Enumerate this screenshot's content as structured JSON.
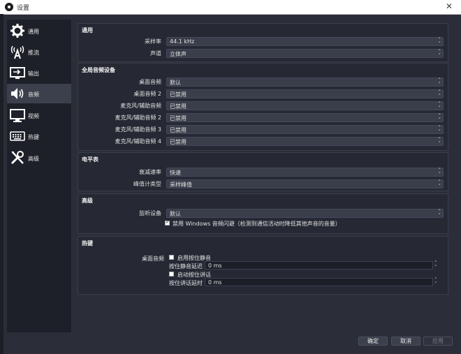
{
  "window": {
    "title": "设置",
    "close_glyph": "✕"
  },
  "sidebar": {
    "items": [
      {
        "label": "通用",
        "icon": "gear-icon",
        "active": false
      },
      {
        "label": "推流",
        "icon": "antenna-icon",
        "active": false
      },
      {
        "label": "输出",
        "icon": "output-icon",
        "active": false
      },
      {
        "label": "音频",
        "icon": "speaker-icon",
        "active": true
      },
      {
        "label": "视频",
        "icon": "monitor-icon",
        "active": false
      },
      {
        "label": "热键",
        "icon": "keyboard-icon",
        "active": false
      },
      {
        "label": "高级",
        "icon": "tools-icon",
        "active": false
      }
    ]
  },
  "general": {
    "title": "通用",
    "sample_rate_label": "采样率",
    "sample_rate_value": "44.1 kHz",
    "channels_label": "声道",
    "channels_value": "立体声"
  },
  "global_devices": {
    "title": "全局音频设备",
    "rows": [
      {
        "label": "桌面音频",
        "value": "默认"
      },
      {
        "label": "桌面音频 2",
        "value": "已禁用"
      },
      {
        "label": "麦克风/辅助音频",
        "value": "已禁用"
      },
      {
        "label": "麦克风/辅助音频 2",
        "value": "已禁用"
      },
      {
        "label": "麦克风/辅助音频 3",
        "value": "已禁用"
      },
      {
        "label": "麦克风/辅助音频 4",
        "value": "已禁用"
      }
    ]
  },
  "meters": {
    "title": "电平表",
    "decay_label": "衰减速率",
    "decay_value": "快速",
    "peak_label": "峰值计类型",
    "peak_value": "采样峰值"
  },
  "advanced": {
    "title": "高级",
    "monitor_label": "监听设备",
    "monitor_value": "默认",
    "ducking_label": "禁用 Windows 音频闪避（检测到通信活动时降低其他声音的音量）",
    "ducking_checked": true
  },
  "hotkeys": {
    "title": "热键",
    "source_label": "桌面音频",
    "push_to_mute_label": "启用按住静音",
    "push_to_mute_delay_label": "按住静音延迟",
    "push_to_mute_delay_value": "0 ms",
    "push_to_talk_label": "启动按住讲话",
    "push_to_talk_delay_label": "按住讲话延时",
    "push_to_talk_delay_value": "0 ms"
  },
  "buttons": {
    "ok": "确定",
    "cancel": "取消",
    "apply": "应用"
  },
  "colors": {
    "background": "#2b2e38",
    "panel": "#262934",
    "sidebar": "#1e2029",
    "active": "#3c404d"
  }
}
